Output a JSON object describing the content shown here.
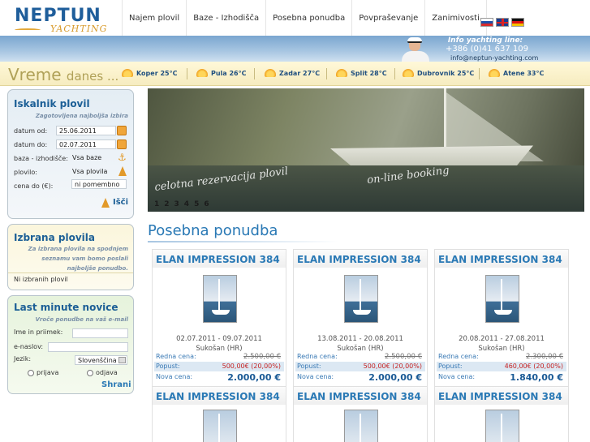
{
  "header": {
    "logo_main": "NEPTUN",
    "logo_sub": "YACHTING",
    "nav": [
      "Najem plovil",
      "Baze - Izhodišča",
      "Posebna ponudba",
      "Povpraševanje",
      "Zanimivosti"
    ],
    "info_title": "Info yachting line:",
    "info_phone": "+386 (0)41 637 109",
    "info_email": "info@neptun-yachting.com",
    "languages": [
      "slovenian-flag",
      "english-flag",
      "german-flag"
    ]
  },
  "weather": {
    "title": "Vreme",
    "title_small": "danes ...",
    "cities": [
      {
        "label": "Koper 25°C"
      },
      {
        "label": "Pula 26°C"
      },
      {
        "label": "Zadar 27°C"
      },
      {
        "label": "Split 28°C"
      },
      {
        "label": "Dubrovnik 25°C"
      },
      {
        "label": "Atene 33°C"
      }
    ]
  },
  "search": {
    "title": "Iskalnik plovil",
    "subtitle": "Zagotovljena najboljša izbira",
    "date_from_label": "datum od:",
    "date_from": "25.06.2011",
    "date_to_label": "datum do:",
    "date_to": "02.07.2011",
    "base_label": "baza - izhodišče:",
    "base_value": "Vsa baze",
    "vessel_label": "plovilo:",
    "vessel_value": "Vsa plovila",
    "price_label": "cena do (€):",
    "price_value": "ni pomembno",
    "search_button": "Išči"
  },
  "selected": {
    "title": "Izbrana plovila",
    "note": "Za izbrana plovila na spodnjem seznamu vam bomo poslali najboljše ponudbo.",
    "empty": "Ni izbranih plovil"
  },
  "newsletter": {
    "title": "Last minute novice",
    "note": "Vroče ponudbe na vaš e-mail",
    "name_label": "Ime in priimek:",
    "email_label": "e-naslov:",
    "lang_label": "Jezik:",
    "lang_value": "Slovenščina",
    "subscribe": "prijava",
    "unsubscribe": "odjava",
    "save": "Shrani"
  },
  "hero": {
    "caption1": "celotna rezervacija plovil",
    "caption2": "on-line booking",
    "pages": [
      "1",
      "2",
      "3",
      "4",
      "5",
      "6"
    ]
  },
  "offers": {
    "title": "Posebna ponudba",
    "labels": {
      "regular": "Redna cena:",
      "discount": "Popust:",
      "new": "Nova cena:"
    },
    "cards": [
      {
        "name": "ELAN IMPRESSION 384",
        "dates": "02.07.2011 - 09.07.2011",
        "location": "Sukošan (HR)",
        "regular": "2.500,00 €",
        "discount": "500,00€ (20,00%)",
        "new": "2.000,00 €"
      },
      {
        "name": "ELAN IMPRESSION 384",
        "dates": "13.08.2011 - 20.08.2011",
        "location": "Sukošan (HR)",
        "regular": "2.500,00 €",
        "discount": "500,00€ (20,00%)",
        "new": "2.000,00 €"
      },
      {
        "name": "ELAN IMPRESSION 384",
        "dates": "20.08.2011 - 27.08.2011",
        "location": "Sukošan (HR)",
        "regular": "2.300,00 €",
        "discount": "460,00€ (20,00%)",
        "new": "1.840,00 €"
      }
    ],
    "cards_row2": [
      {
        "name": "ELAN IMPRESSION 384"
      },
      {
        "name": "ELAN IMPRESSION 384"
      },
      {
        "name": "ELAN IMPRESSION 384"
      }
    ]
  }
}
